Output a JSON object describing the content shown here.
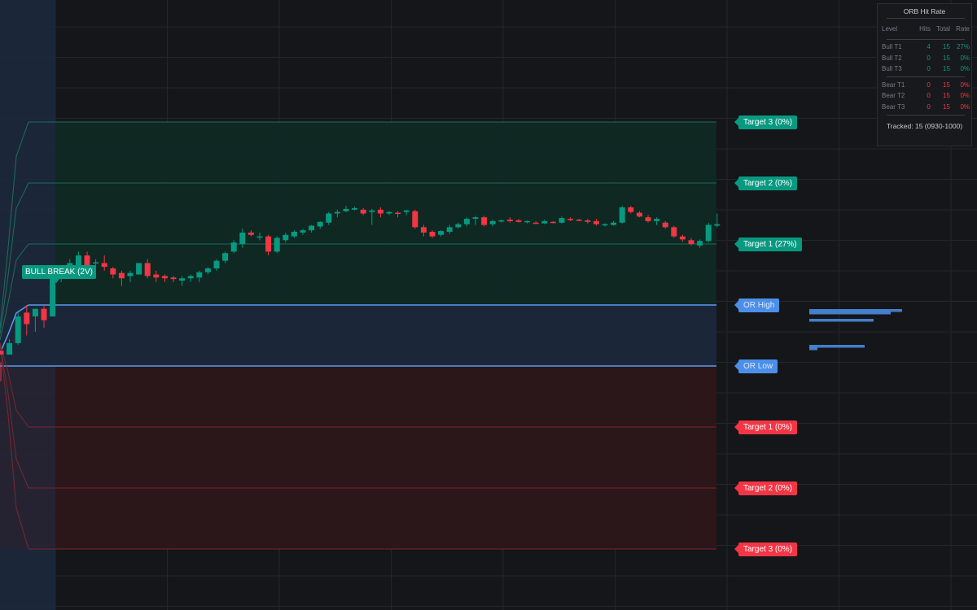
{
  "colors": {
    "background": "#141619",
    "bull": "#089981",
    "bear": "#f23645",
    "or_line": "#5b9cf0",
    "grid": "#23262c"
  },
  "chart_data": {
    "type": "candlestick",
    "grid": true,
    "y_range": [
      22,
      98
    ],
    "x_range": [
      0,
      80
    ],
    "opening_range": {
      "high": 60,
      "low": 52,
      "label_high": "OR High",
      "label_low": "OR Low"
    },
    "bull_targets": [
      {
        "level": 68,
        "label": "Target 1 (27%)"
      },
      {
        "level": 76,
        "label": "Target 2 (0%)"
      },
      {
        "level": 84,
        "label": "Target 3 (0%)"
      }
    ],
    "bear_targets": [
      {
        "level": 44,
        "label": "Target 1 (0%)"
      },
      {
        "level": 36,
        "label": "Target 2 (0%)"
      },
      {
        "level": 28,
        "label": "Target 3 (0%)"
      }
    ],
    "break_label": {
      "text": "BULL BREAK (2V)",
      "x": 4.5
    },
    "candles": [
      [
        0,
        54.0,
        52.5,
        50.0,
        53.5
      ],
      [
        1,
        53.5,
        55.5,
        53.5,
        55.0
      ],
      [
        2,
        55.0,
        59.0,
        54.8,
        58.5
      ],
      [
        3,
        59.0,
        60.0,
        56.0,
        57.5
      ],
      [
        4,
        58.5,
        59.5,
        56.5,
        59.5
      ],
      [
        5,
        59.5,
        60.0,
        57.0,
        58.0
      ],
      [
        6,
        58.5,
        64.0,
        58.5,
        63.5
      ],
      [
        7,
        63.5,
        65.0,
        63.0,
        64.5
      ],
      [
        8,
        64.0,
        66.0,
        63.5,
        65.5
      ],
      [
        9,
        65.0,
        67.0,
        64.5,
        66.5
      ],
      [
        10,
        66.5,
        67.0,
        64.5,
        65.0
      ],
      [
        11,
        65.5,
        66.0,
        65.0,
        65.6
      ],
      [
        12,
        65.5,
        66.5,
        64.5,
        65.0
      ],
      [
        13,
        64.8,
        65.0,
        63.5,
        64.0
      ],
      [
        14,
        64.2,
        64.5,
        62.5,
        63.5
      ],
      [
        15,
        63.8,
        64.5,
        63.0,
        64.2
      ],
      [
        16,
        64.0,
        65.5,
        64.0,
        65.5
      ],
      [
        17,
        65.5,
        66.0,
        63.5,
        63.8
      ],
      [
        18,
        64.0,
        64.5,
        63.0,
        63.6
      ],
      [
        19,
        63.8,
        64.0,
        63.0,
        63.5
      ],
      [
        20,
        63.6,
        63.8,
        63.0,
        63.4
      ],
      [
        21,
        63.2,
        63.8,
        62.5,
        63.5
      ],
      [
        22,
        63.5,
        64.0,
        63.0,
        63.8
      ],
      [
        23,
        63.6,
        64.5,
        63.0,
        64.3
      ],
      [
        24,
        64.3,
        65.0,
        64.0,
        64.8
      ],
      [
        25,
        64.8,
        66.0,
        64.5,
        65.8
      ],
      [
        26,
        65.8,
        67.0,
        65.5,
        66.8
      ],
      [
        27,
        67.0,
        68.5,
        66.8,
        68.2
      ],
      [
        28,
        68.0,
        70.0,
        67.5,
        69.5
      ],
      [
        29,
        69.5,
        69.8,
        69.0,
        69.2
      ],
      [
        30,
        69.0,
        69.5,
        68.5,
        69.0
      ],
      [
        31,
        69.0,
        69.2,
        66.5,
        67.0
      ],
      [
        32,
        67.0,
        69.0,
        66.8,
        68.8
      ],
      [
        33,
        68.5,
        69.5,
        68.2,
        69.2
      ],
      [
        34,
        69.0,
        69.8,
        68.8,
        69.6
      ],
      [
        35,
        69.5,
        70.0,
        69.2,
        69.8
      ],
      [
        36,
        69.8,
        70.5,
        69.5,
        70.4
      ],
      [
        37,
        70.3,
        71.0,
        70.0,
        70.9
      ],
      [
        38,
        70.8,
        72.2,
        70.5,
        72.0
      ],
      [
        39,
        72.0,
        72.5,
        71.5,
        72.2
      ],
      [
        40,
        72.3,
        73.0,
        72.2,
        72.6
      ],
      [
        41,
        72.5,
        72.9,
        72.4,
        72.7
      ],
      [
        42,
        72.5,
        72.7,
        71.8,
        72.0
      ],
      [
        43,
        72.2,
        72.6,
        70.5,
        72.4
      ],
      [
        44,
        72.5,
        72.8,
        71.5,
        72.0
      ],
      [
        45,
        72.0,
        72.3,
        71.8,
        72.2
      ],
      [
        46,
        72.1,
        72.3,
        71.5,
        72.0
      ],
      [
        47,
        72.2,
        72.5,
        71.8,
        72.4
      ],
      [
        48,
        72.3,
        72.5,
        70.0,
        70.2
      ],
      [
        49,
        70.2,
        70.5,
        69.0,
        69.5
      ],
      [
        50,
        69.6,
        69.8,
        68.8,
        69.0
      ],
      [
        51,
        69.2,
        69.8,
        69.0,
        69.7
      ],
      [
        52,
        69.6,
        70.5,
        69.3,
        70.2
      ],
      [
        53,
        70.2,
        70.8,
        70.0,
        70.6
      ],
      [
        54,
        70.6,
        71.5,
        70.3,
        71.3
      ],
      [
        55,
        71.3,
        71.7,
        70.5,
        71.5
      ],
      [
        56,
        71.5,
        71.7,
        70.3,
        70.5
      ],
      [
        57,
        70.6,
        71.2,
        70.3,
        71.0
      ],
      [
        58,
        71.0,
        71.2,
        70.8,
        71.1
      ],
      [
        59,
        71.2,
        71.5,
        70.8,
        71.0
      ],
      [
        60,
        71.1,
        71.3,
        70.8,
        70.9
      ],
      [
        61,
        70.9,
        71.1,
        70.7,
        71.0
      ],
      [
        62,
        70.8,
        71.0,
        70.6,
        70.7
      ],
      [
        63,
        70.7,
        71.2,
        70.6,
        71.0
      ],
      [
        64,
        70.9,
        71.0,
        70.7,
        70.8
      ],
      [
        65,
        70.8,
        71.6,
        70.7,
        71.4
      ],
      [
        66,
        71.3,
        71.5,
        71.0,
        71.2
      ],
      [
        67,
        71.2,
        71.3,
        71.0,
        71.1
      ],
      [
        68,
        71.1,
        71.3,
        70.7,
        70.9
      ],
      [
        69,
        71.0,
        71.3,
        70.4,
        70.6
      ],
      [
        70,
        70.5,
        70.7,
        70.3,
        70.6
      ],
      [
        71,
        70.5,
        71.0,
        70.4,
        70.8
      ],
      [
        72,
        70.8,
        73.0,
        70.7,
        72.8
      ],
      [
        73,
        72.8,
        73.0,
        72.0,
        72.2
      ],
      [
        74,
        72.1,
        72.3,
        71.5,
        71.6
      ],
      [
        75,
        71.5,
        71.8,
        70.8,
        71.0
      ],
      [
        76,
        71.0,
        71.5,
        70.5,
        71.3
      ],
      [
        77,
        70.8,
        71.0,
        70.0,
        70.2
      ],
      [
        78,
        70.2,
        70.4,
        68.8,
        69.0
      ],
      [
        79,
        69.0,
        69.2,
        68.3,
        68.6
      ],
      [
        80,
        68.5,
        68.8,
        67.8,
        68.0
      ],
      [
        81,
        67.8,
        68.6,
        67.5,
        68.4
      ],
      [
        82,
        68.4,
        70.8,
        68.2,
        70.5
      ],
      [
        83,
        70.4,
        72.0,
        70.2,
        70.6
      ]
    ]
  },
  "hit_rate_panel": {
    "title": "ORB Hit Rate",
    "columns": [
      "Level",
      "Hits",
      "Total",
      "Rate"
    ],
    "bull_rows": [
      [
        "Bull T1",
        "4",
        "15",
        "27%"
      ],
      [
        "Bull T2",
        "0",
        "15",
        "0%"
      ],
      [
        "Bull T3",
        "0",
        "15",
        "0%"
      ]
    ],
    "bear_rows": [
      [
        "Bear T1",
        "0",
        "15",
        "0%"
      ],
      [
        "Bear T2",
        "0",
        "15",
        "0%"
      ],
      [
        "Bear T3",
        "0",
        "15",
        "0%"
      ]
    ],
    "footer": "Tracked: 15 (0930-1000)"
  }
}
